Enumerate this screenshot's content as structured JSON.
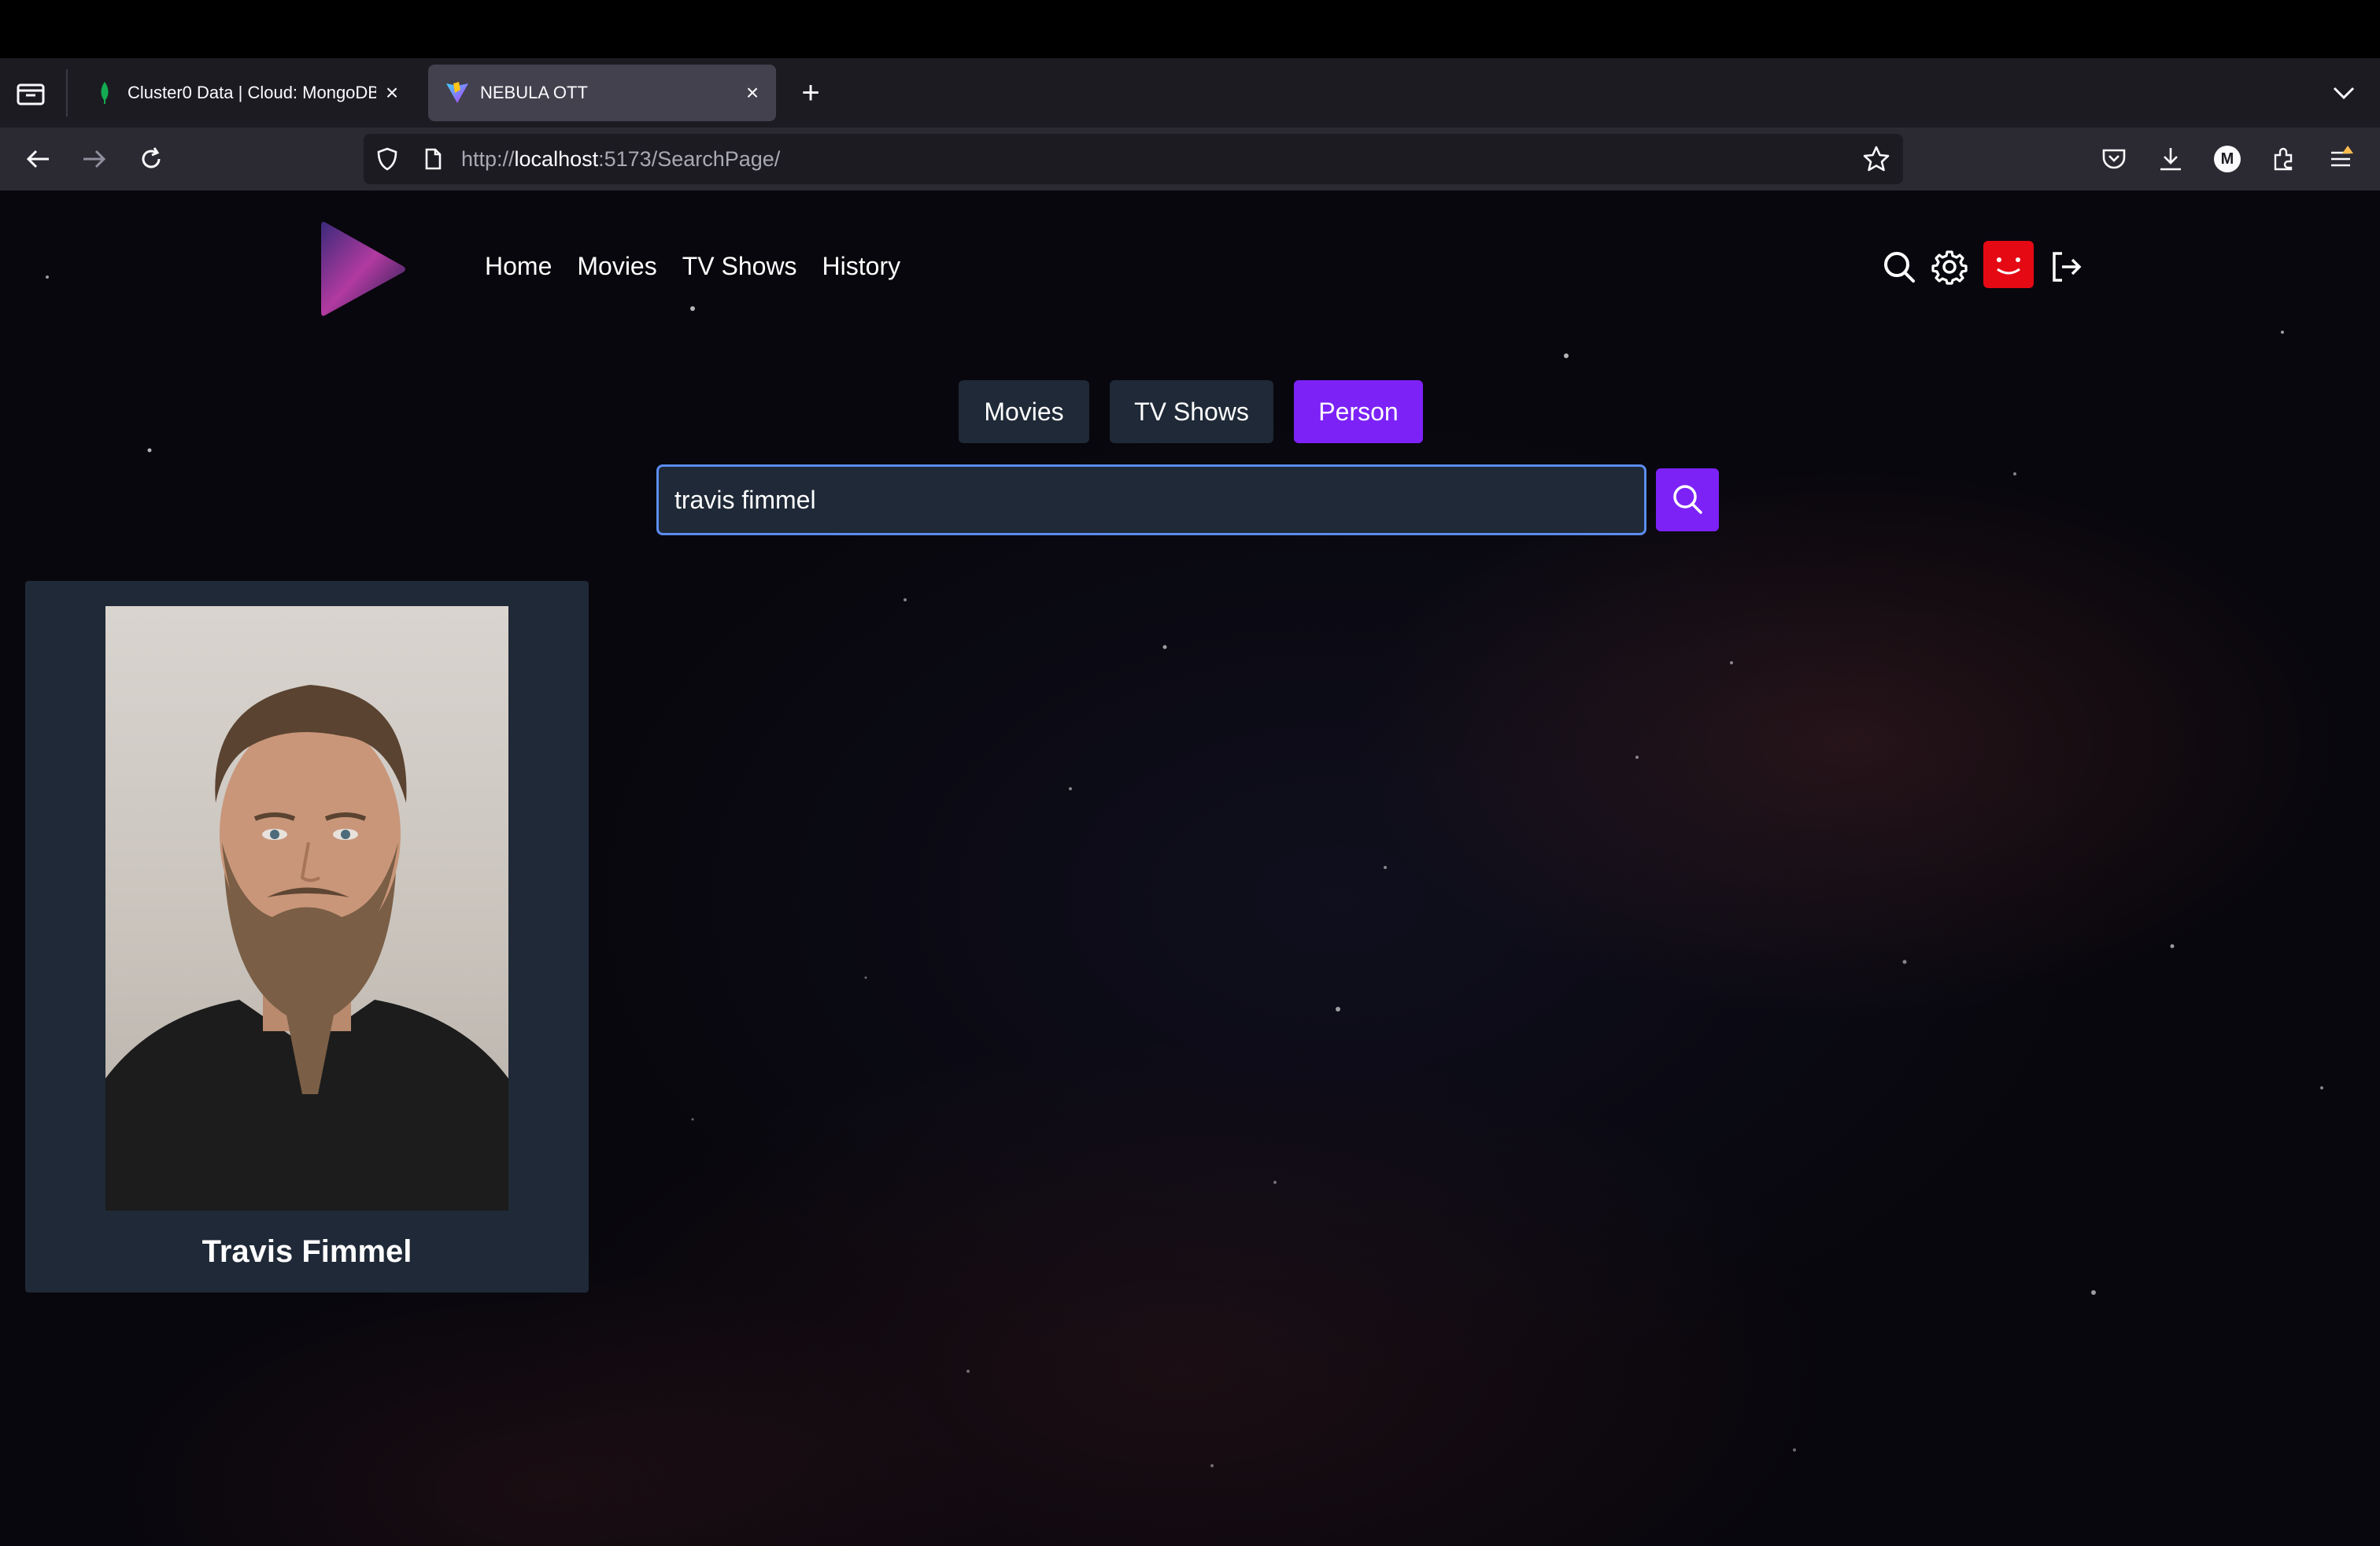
{
  "browser": {
    "tabs": [
      {
        "title": "Cluster0 Data | Cloud: MongoDB",
        "favicon": "mongodb-leaf-icon",
        "active": false
      },
      {
        "title": "NEBULA OTT",
        "favicon": "vite-icon",
        "active": true
      }
    ],
    "url": {
      "scheme": "http://",
      "host": "localhost",
      "rest": ":5173/SearchPage/"
    },
    "account_initial": "M"
  },
  "site": {
    "nav": [
      {
        "label": "Home"
      },
      {
        "label": "Movies"
      },
      {
        "label": "TV Shows"
      },
      {
        "label": "History"
      }
    ],
    "icons": [
      "search-icon",
      "gear-icon",
      "avatar",
      "logout-icon"
    ]
  },
  "search": {
    "categories": [
      {
        "label": "Movies",
        "active": false
      },
      {
        "label": "TV Shows",
        "active": false
      },
      {
        "label": "Person",
        "active": true
      }
    ],
    "query": "travis fimmel"
  },
  "results": [
    {
      "name": "Travis Fimmel"
    }
  ],
  "colors": {
    "accent": "#7c22f7",
    "card": "#1f2937",
    "avatar": "#e50914"
  }
}
